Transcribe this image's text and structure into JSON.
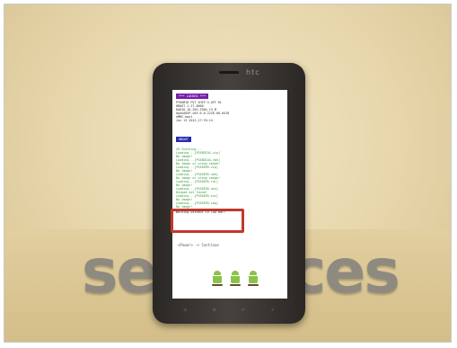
{
  "background": {
    "word_left": "se",
    "word_right": "ces"
  },
  "phone": {
    "brand": "htc"
  },
  "screen": {
    "header": "*** LOCKED ***",
    "info": [
      "PYRAMID PVT SHIP S-OFF RL",
      "HBOOT-1.27.0000",
      "RADIO-10.20G.3504.13_M",
      "OpenADSP-v05.6.0.2226.00.0418",
      "eMMC-boot",
      "Jun 13 2012,17:33:14"
    ],
    "boot_label": "HBOOT",
    "checks": [
      "SD Checking...",
      "Loading...[PG58DIAG.zip]",
      "No image!",
      "Loading...[PG58DIAG.nbh]",
      "No image or wrong image!",
      "Loading...[PG58IMG.zip]",
      "No image!",
      "Loading...[PG58IMG.nbh]",
      "No image or wrong image!",
      "Loading...[PG58IMG.tar]",
      "No image!",
      "Loading...[PG58IMG.aes]",
      "Keypad not found!",
      "Loading...[PG58IMG.enc]",
      "No image!",
      "Loading...[PG58IMG.img]",
      "No image!"
    ],
    "footer_line": "Working without in low Bat!",
    "menu": "<Power> -> Continue"
  },
  "softkeys": [
    "home-icon",
    "menu-icon",
    "back-icon",
    "search-icon"
  ],
  "colors": {
    "highlight": "#c0392b",
    "android_green": "#8bc34a",
    "locked_tag": "#7a1ea8"
  }
}
